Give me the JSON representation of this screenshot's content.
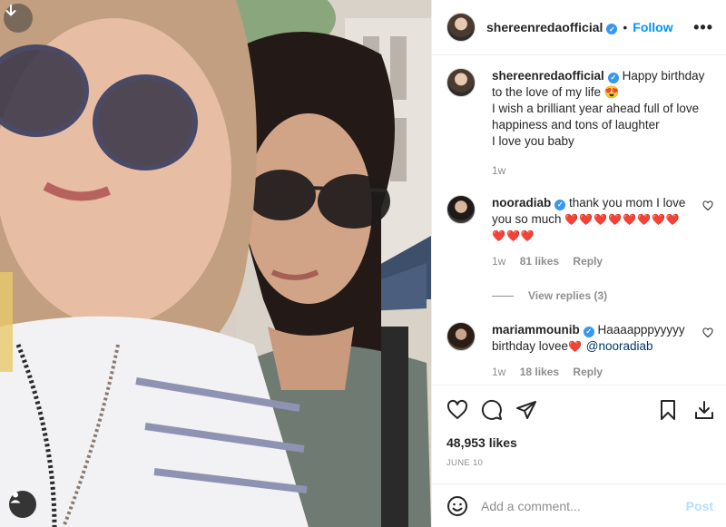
{
  "post": {
    "username": "shereenredaofficial",
    "dot": "•",
    "follow_label": "Follow",
    "more_label": "•••"
  },
  "caption": {
    "username": "shereenredaofficial",
    "text_line1": "Happy birthday to the love of my life 😍",
    "text_line2": "I wish a brilliant year ahead full of love happiness and tons of laughter",
    "text_line3": "I love you baby",
    "time": "1w"
  },
  "comments": [
    {
      "username": "nooradiab",
      "text": "thank you mom I love you so much",
      "hearts": "❤️❤️❤️❤️❤️❤️❤️❤️❤️❤️❤️",
      "time": "1w",
      "likes": "81 likes",
      "reply": "Reply",
      "view_replies": "View replies (3)"
    },
    {
      "username": "mariammounib",
      "text": "Haaaapppyyyyy birthday lovee",
      "heart": "❤️",
      "mention": "@nooradiab",
      "time": "1w",
      "likes": "18 likes",
      "reply": "Reply"
    }
  ],
  "stats": {
    "likes": "48,953 likes",
    "date": "JUNE 10"
  },
  "add_comment": {
    "placeholder": "Add a comment...",
    "post_label": "Post"
  },
  "colors": {
    "accent": "#0095f6",
    "verified": "#3897f0",
    "muted": "#8e8e8e",
    "post_disabled": "#b2dffc"
  }
}
